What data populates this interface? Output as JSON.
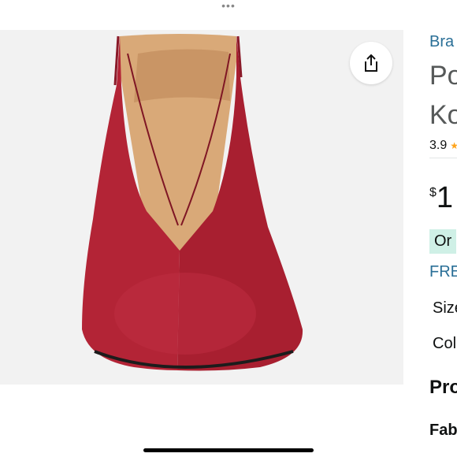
{
  "top_handle": {
    "glyph": "•••"
  },
  "product_image": {
    "alt": ""
  },
  "share_icon": "share-icon",
  "details": {
    "brand": "Bra",
    "title_line1": "Po",
    "title_line2": "Ko",
    "rating": "3.9",
    "price_symbol": "$",
    "price_value": "1",
    "offer_badge": "Or",
    "shipping": "FRE",
    "size_label": "Size",
    "color_label": "Col",
    "section_product": "Pro",
    "section_fabric": "Fab"
  },
  "colors": {
    "link": "#2a6f97",
    "badge": "#cff0e6",
    "shoe_leather": "#b32436",
    "image_bg": "#f2f2f2"
  }
}
